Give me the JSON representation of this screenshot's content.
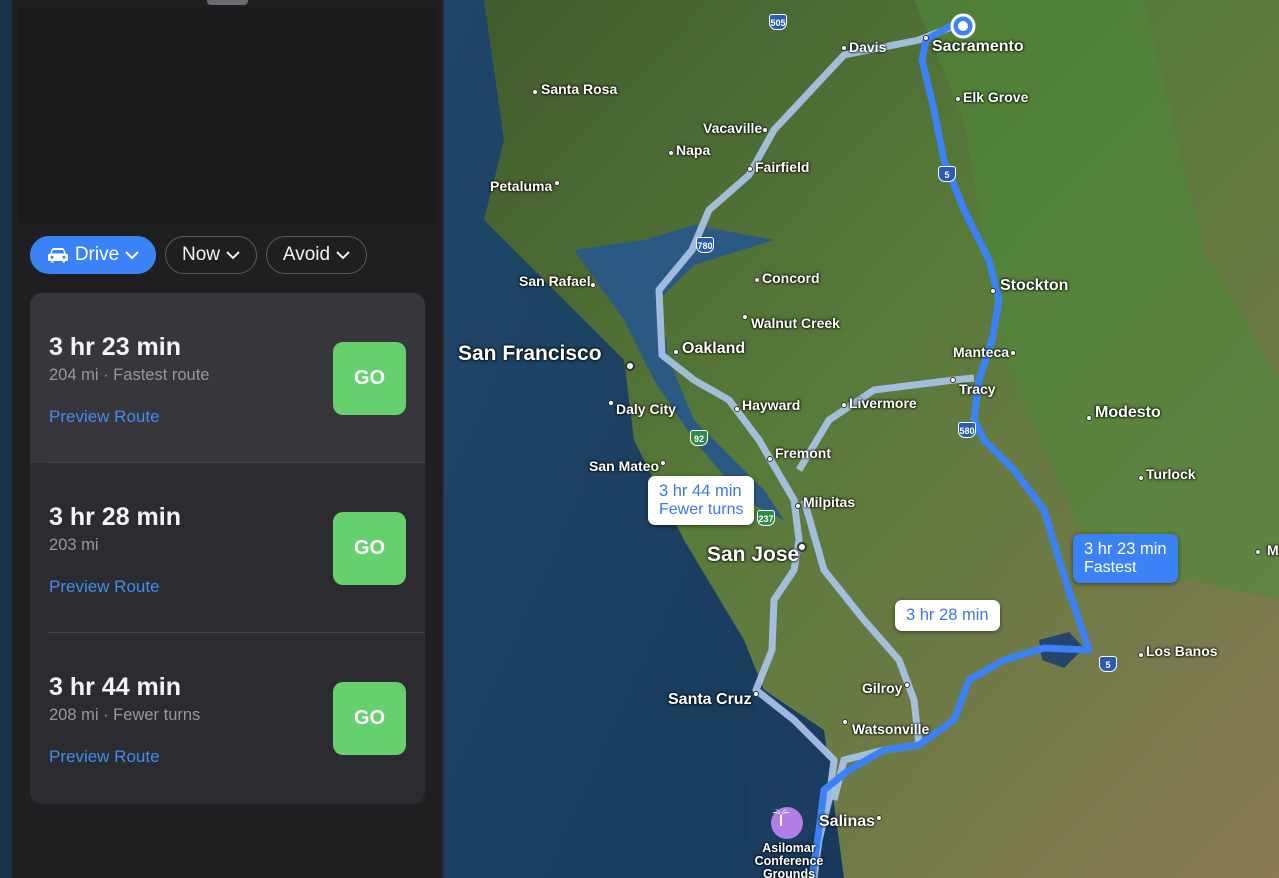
{
  "controls": {
    "drive_label": "Drive",
    "now_label": "Now",
    "avoid_label": "Avoid"
  },
  "routes": [
    {
      "time": "3 hr 23 min",
      "detail": "204 mi · Fastest route",
      "preview": "Preview Route",
      "go": "GO",
      "selected": true
    },
    {
      "time": "3 hr 28 min",
      "detail": "203 mi",
      "preview": "Preview Route",
      "go": "GO",
      "selected": false
    },
    {
      "time": "3 hr 44 min",
      "detail": "208 mi · Fewer turns",
      "preview": "Preview Route",
      "go": "GO",
      "selected": false
    }
  ],
  "map": {
    "callouts": {
      "fastest": {
        "time": "3 hr 23 min",
        "note": "Fastest"
      },
      "fewer_turns": {
        "time": "3 hr 44 min",
        "note": "Fewer turns"
      },
      "alt": {
        "time": "3 hr 28 min"
      }
    },
    "cities": {
      "sacramento": "Sacramento",
      "davis": "Davis",
      "elk_grove": "Elk Grove",
      "santa_rosa": "Santa Rosa",
      "vacaville": "Vacaville",
      "napa": "Napa",
      "fairfield": "Fairfield",
      "petaluma": "Petaluma",
      "san_rafael": "San Rafael",
      "concord": "Concord",
      "walnut_creek": "Walnut Creek",
      "stockton": "Stockton",
      "san_francisco": "San Francisco",
      "oakland": "Oakland",
      "manteca": "Manteca",
      "tracy": "Tracy",
      "daly_city": "Daly City",
      "hayward": "Hayward",
      "livermore": "Livermore",
      "modesto": "Modesto",
      "fremont": "Fremont",
      "san_mateo": "San Mateo",
      "turlock": "Turlock",
      "milpitas": "Milpitas",
      "san_jose": "San Jose",
      "merced_partial": "Me",
      "los_banos": "Los Banos",
      "gilroy": "Gilroy",
      "santa_cruz": "Santa Cruz",
      "watsonville": "Watsonville",
      "salinas": "Salinas"
    },
    "poi": "Asilomar Conference Grounds",
    "shields": {
      "i505": "505",
      "i5a": "5",
      "i780": "780",
      "i580": "580",
      "s92": "92",
      "s237": "237",
      "i5b": "5"
    },
    "colors": {
      "route_primary": "#3a82f6",
      "route_alt": "#a9c3e8",
      "go_button": "#66d06e"
    }
  }
}
